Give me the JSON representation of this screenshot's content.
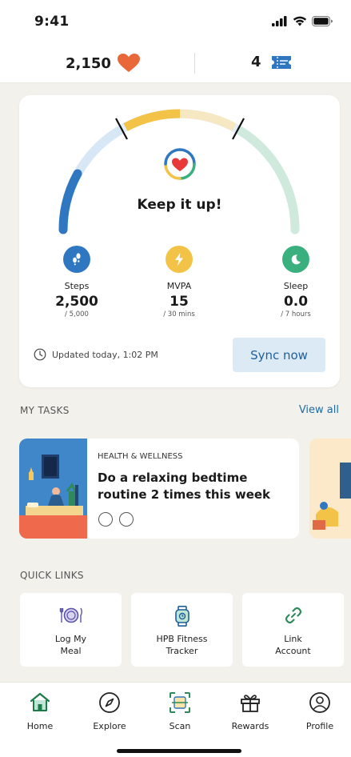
{
  "status_bar": {
    "time": "9:41"
  },
  "header": {
    "points": "2,150",
    "ticket_count": "4"
  },
  "activity": {
    "message": "Keep it up!",
    "metrics": [
      {
        "label": "Steps",
        "value": "2,500",
        "target": "/ 5,000",
        "icon": "footsteps-icon",
        "color": "#2f77c0"
      },
      {
        "label": "MVPA",
        "value": "15",
        "target": "/ 30 mins",
        "icon": "lightning-icon",
        "color": "#f2c347"
      },
      {
        "label": "Sleep",
        "value": "0.0",
        "target": "/ 7 hours",
        "icon": "moon-icon",
        "color": "#3bb07f"
      }
    ],
    "updated": "Updated today, 1:02 PM",
    "sync_label": "Sync now"
  },
  "tasks": {
    "title": "MY TASKS",
    "view_all": "View all",
    "items": [
      {
        "category": "HEALTH & WELLNESS",
        "title": "Do a relaxing bedtime routine 2 times this week",
        "total_checks": 2,
        "completed_checks": 0
      }
    ]
  },
  "quick_links": {
    "title": "QUICK LINKS",
    "items": [
      {
        "label": "Log My\nMeal",
        "icon": "plate-icon"
      },
      {
        "label": "HPB Fitness\nTracker",
        "icon": "smartwatch-icon"
      },
      {
        "label": "Link\nAccount",
        "icon": "link-icon"
      }
    ]
  },
  "tabs": [
    {
      "label": "Home",
      "icon": "home-icon",
      "active": true
    },
    {
      "label": "Explore",
      "icon": "compass-icon"
    },
    {
      "label": "Scan",
      "icon": "scan-icon"
    },
    {
      "label": "Rewards",
      "icon": "gift-icon"
    },
    {
      "label": "Profile",
      "icon": "user-icon"
    }
  ],
  "colors": {
    "primary": "#1f6aa5",
    "sync_bg": "#dbeaf5",
    "heart": "#e8683a",
    "active_tab": "#1d7b4a"
  }
}
